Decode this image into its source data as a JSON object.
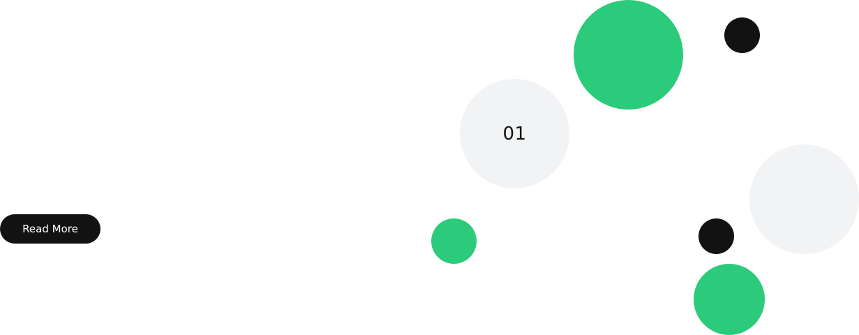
{
  "step": {
    "number": "01"
  },
  "actions": {
    "read_more_label": "Read More"
  },
  "colors": {
    "accent_green": "#2bcb7b",
    "dark": "#121212",
    "light_gray": "#f2f3f5",
    "background": "#ffffff"
  }
}
